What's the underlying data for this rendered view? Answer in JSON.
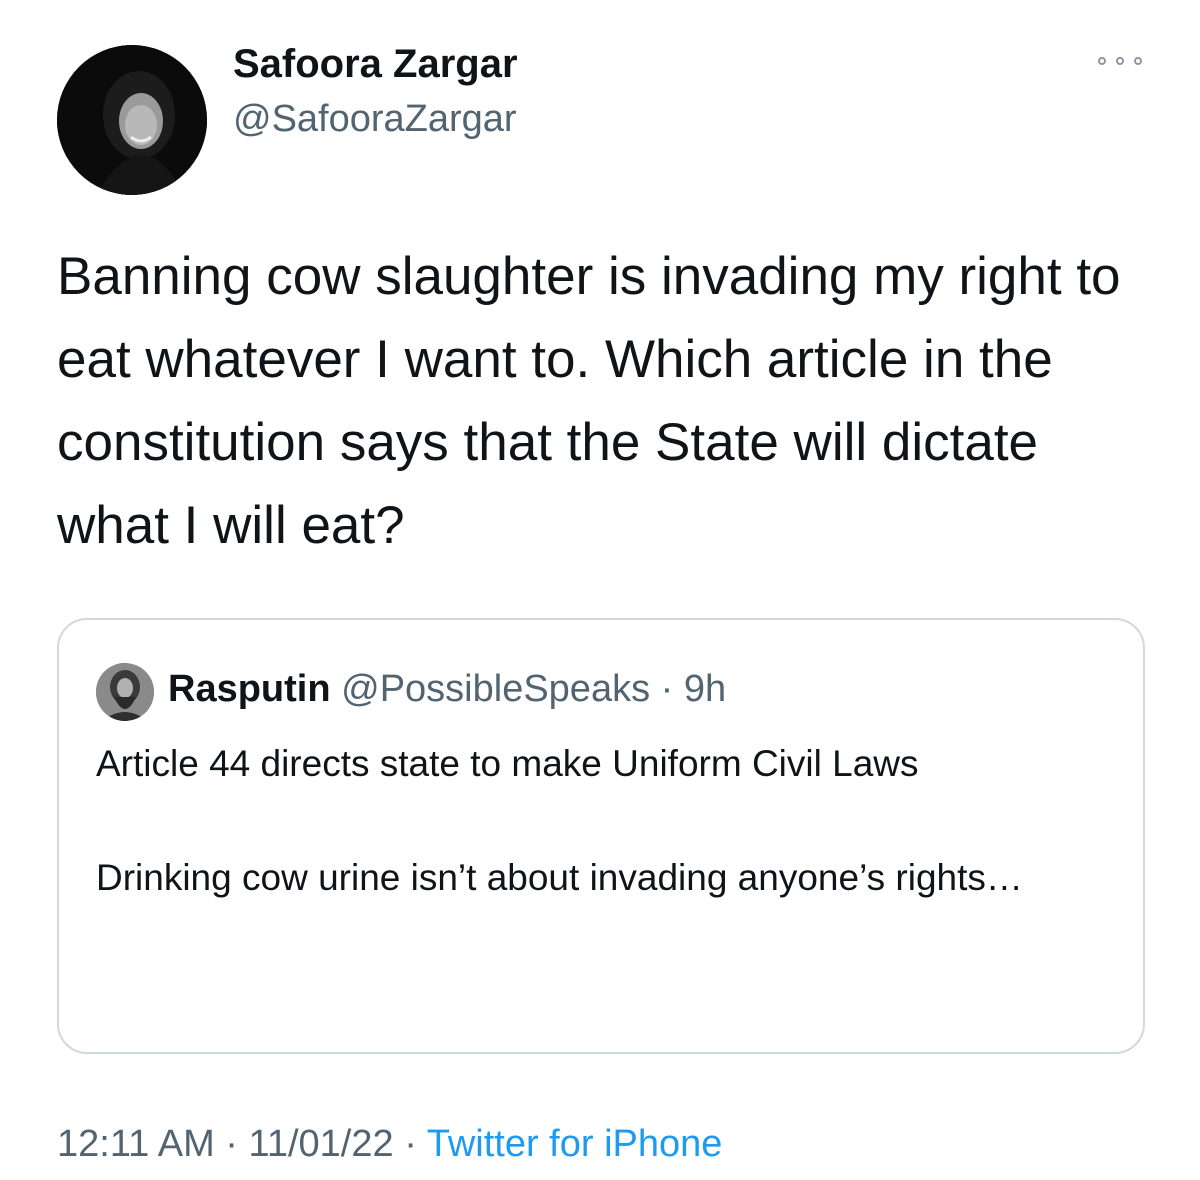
{
  "author": {
    "name": "Safoora Zargar",
    "handle": "@SafooraZargar"
  },
  "tweet": {
    "text": "Banning cow slaughter is invading my right to eat whatever I want to. Which article in the constitution says that the State will dictate what I will eat?"
  },
  "quoted_tweet": {
    "name": "Rasputin",
    "handle": "@PossibleSpeaks",
    "separator": "·",
    "time": "9h",
    "paragraph_1": "Article 44 directs state to make Uniform Civil Laws",
    "paragraph_2": "Drinking cow urine isn’t about invading anyone’s rights…"
  },
  "footer": {
    "time": "12:11 AM",
    "separator_1": "·",
    "date": "11/01/22",
    "separator_2": "·",
    "source": "Twitter for iPhone"
  },
  "icons": {
    "more": "more-horizontal-icon"
  },
  "colors": {
    "text_primary": "#0f1419",
    "text_secondary": "#536471",
    "link": "#1d9bf0",
    "border": "#cfd9de"
  }
}
